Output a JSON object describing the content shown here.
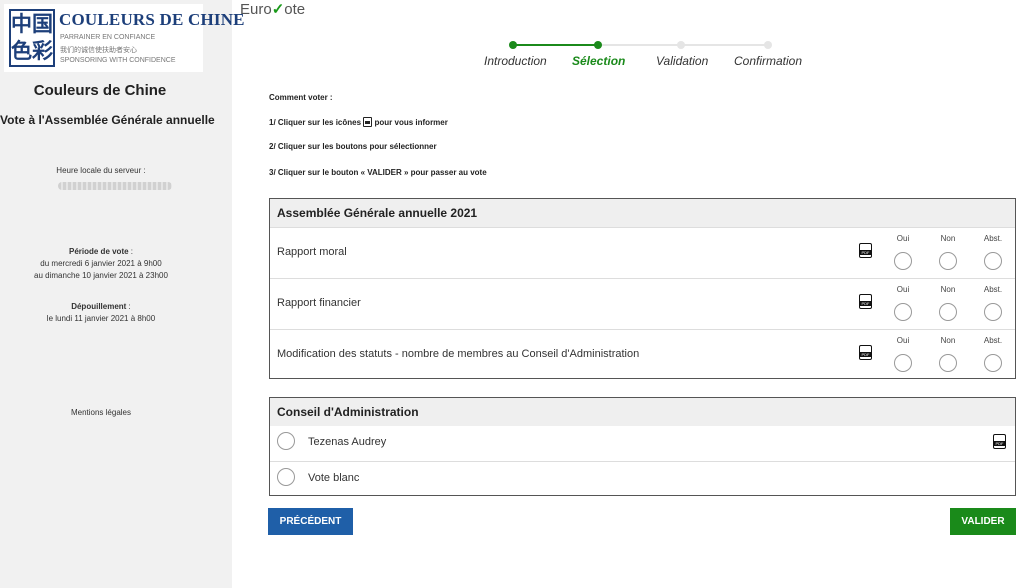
{
  "sidebar": {
    "logo": {
      "cn": "中国色彩",
      "title": "COULEURS DE CHINE",
      "line1": "PARRAINER EN CONFIANCE",
      "line2": "我们的诚信使扶助者安心",
      "line3": "SPONSORING WITH CONFIDENCE"
    },
    "org_name": "Couleurs de Chine",
    "org_subtitle": "Vote à l'Assemblée Générale annuelle",
    "server_time_label": "Heure locale du serveur :",
    "period_label": "Période de vote",
    "period_line1": "du mercredi 6 janvier 2021 à 9h00",
    "period_line2": "au dimanche 10 janvier 2021 à 23h00",
    "count_label": "Dépouillement",
    "count_line": "le lundi 11 janvier 2021 à 8h00",
    "legal": "Mentions légales"
  },
  "header": {
    "brand_a": "Euro",
    "brand_b": "ote",
    "steps": [
      "Introduction",
      "Sélection",
      "Validation",
      "Confirmation"
    ],
    "active_step": 1
  },
  "instructions": {
    "title": "Comment voter :",
    "step1_a": "1/ Cliquer sur les icônes",
    "step1_b": "pour vous informer",
    "step2": "2/ Cliquer sur les boutons pour sélectionner",
    "step3": "3/ Cliquer sur le bouton « VALIDER » pour passer au vote"
  },
  "assembly": {
    "title": "Assemblée Générale annuelle 2021",
    "options": [
      "Oui",
      "Non",
      "Abst."
    ],
    "motions": [
      {
        "label": "Rapport moral"
      },
      {
        "label": "Rapport financier"
      },
      {
        "label": "Modification des statuts - nombre de membres au Conseil d'Administration"
      }
    ]
  },
  "board": {
    "title": "Conseil d'Administration",
    "candidates": [
      {
        "label": "Tezenas Audrey",
        "has_pdf": true
      },
      {
        "label": "Vote blanc",
        "has_pdf": false
      }
    ]
  },
  "buttons": {
    "prev": "PRÉCÉDENT",
    "next": "VALIDER"
  },
  "pdf_text": "PDF",
  "colors": {
    "accent_green": "#1a8a1a",
    "accent_blue": "#1f5fa8",
    "brand_navy": "#1d3f7a"
  }
}
